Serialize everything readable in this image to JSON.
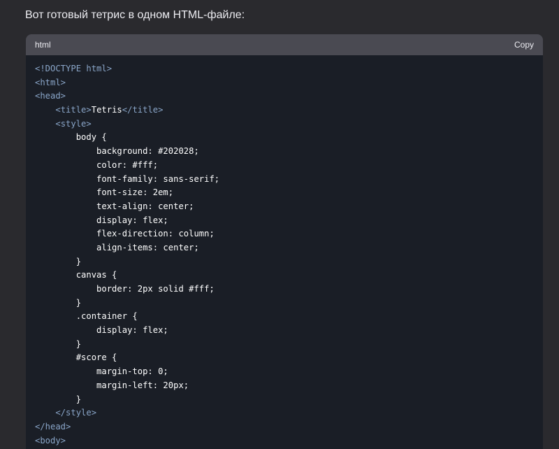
{
  "message": {
    "intro": "Вот готовый тетрис в одном HTML-файле:"
  },
  "code_block": {
    "language": "html",
    "copy_label": "Copy",
    "lines": [
      [
        {
          "t": "tag",
          "v": "<!DOCTYPE html>"
        }
      ],
      [
        {
          "t": "tag",
          "v": "<html>"
        }
      ],
      [
        {
          "t": "tag",
          "v": "<head>"
        }
      ],
      [
        {
          "t": "code",
          "v": "    "
        },
        {
          "t": "tag",
          "v": "<title>"
        },
        {
          "t": "text",
          "v": "Tetris"
        },
        {
          "t": "tag",
          "v": "</title>"
        }
      ],
      [
        {
          "t": "code",
          "v": "    "
        },
        {
          "t": "tag",
          "v": "<style>"
        }
      ],
      [
        {
          "t": "code",
          "v": "        body {"
        }
      ],
      [
        {
          "t": "code",
          "v": "            background: #202028;"
        }
      ],
      [
        {
          "t": "code",
          "v": "            color: #fff;"
        }
      ],
      [
        {
          "t": "code",
          "v": "            font-family: sans-serif;"
        }
      ],
      [
        {
          "t": "code",
          "v": "            font-size: 2em;"
        }
      ],
      [
        {
          "t": "code",
          "v": "            text-align: center;"
        }
      ],
      [
        {
          "t": "code",
          "v": "            display: flex;"
        }
      ],
      [
        {
          "t": "code",
          "v": "            flex-direction: column;"
        }
      ],
      [
        {
          "t": "code",
          "v": "            align-items: center;"
        }
      ],
      [
        {
          "t": "code",
          "v": "        }"
        }
      ],
      [
        {
          "t": "code",
          "v": "        canvas {"
        }
      ],
      [
        {
          "t": "code",
          "v": "            border: 2px solid #fff;"
        }
      ],
      [
        {
          "t": "code",
          "v": "        }"
        }
      ],
      [
        {
          "t": "code",
          "v": "        .container {"
        }
      ],
      [
        {
          "t": "code",
          "v": "            display: flex;"
        }
      ],
      [
        {
          "t": "code",
          "v": "        }"
        }
      ],
      [
        {
          "t": "code",
          "v": "        #score {"
        }
      ],
      [
        {
          "t": "code",
          "v": "            margin-top: 0;"
        }
      ],
      [
        {
          "t": "code",
          "v": "            margin-left: 20px;"
        }
      ],
      [
        {
          "t": "code",
          "v": "        }"
        }
      ],
      [
        {
          "t": "code",
          "v": "    "
        },
        {
          "t": "tag",
          "v": "</style>"
        }
      ],
      [
        {
          "t": "tag",
          "v": "</head>"
        }
      ],
      [
        {
          "t": "tag",
          "v": "<body>"
        }
      ]
    ]
  }
}
